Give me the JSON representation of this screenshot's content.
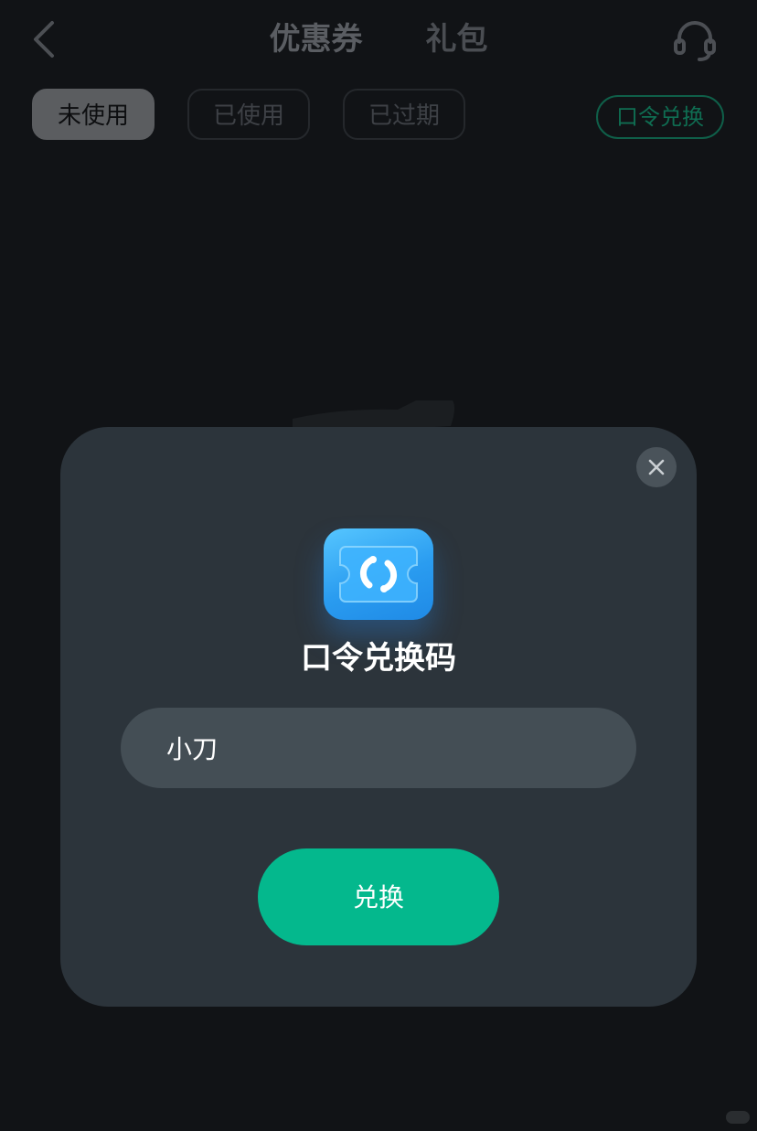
{
  "header": {
    "back_icon": "chevron-left-icon",
    "tabs": [
      {
        "label": "优惠券",
        "active": true
      },
      {
        "label": "礼包",
        "active": false
      }
    ],
    "support_icon": "headset-icon"
  },
  "filters": [
    {
      "label": "未使用",
      "selected": true
    },
    {
      "label": "已使用",
      "selected": false
    },
    {
      "label": "已过期",
      "selected": false
    }
  ],
  "redeem_chip": {
    "label": "口令兑换"
  },
  "modal": {
    "close_icon": "close-icon",
    "icon": "ticket-exchange-icon",
    "title": "口令兑换码",
    "input_value": "小刀",
    "button_label": "兑换"
  },
  "colors": {
    "accent": "#04b88d",
    "modal_bg": "#2c343b",
    "page_bg": "#111316",
    "input_bg": "#444e55",
    "icon_blue": "#2a9cf0"
  }
}
